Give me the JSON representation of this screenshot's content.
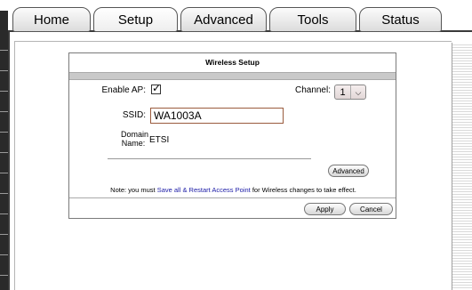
{
  "tabs": [
    {
      "label": "Home"
    },
    {
      "label": "Setup",
      "active": true
    },
    {
      "label": "Advanced"
    },
    {
      "label": "Tools"
    },
    {
      "label": "Status"
    }
  ],
  "dialog": {
    "title": "Wireless Setup",
    "enable_ap_label": "Enable AP:",
    "enable_ap_checked": true,
    "channel_label": "Channel:",
    "channel_value": "1",
    "ssid_label": "SSID:",
    "ssid_value": "WA1003A",
    "domain_label_line1": "Domain",
    "domain_label_line2": "Name:",
    "domain_value": "ETSI",
    "advanced_button": "Advanced",
    "note_prefix": "Note: you must ",
    "note_link": "Save all & Restart Access Point",
    "note_suffix": " for Wireless changes to take effect.",
    "apply_button": "Apply",
    "cancel_button": "Cancel"
  }
}
